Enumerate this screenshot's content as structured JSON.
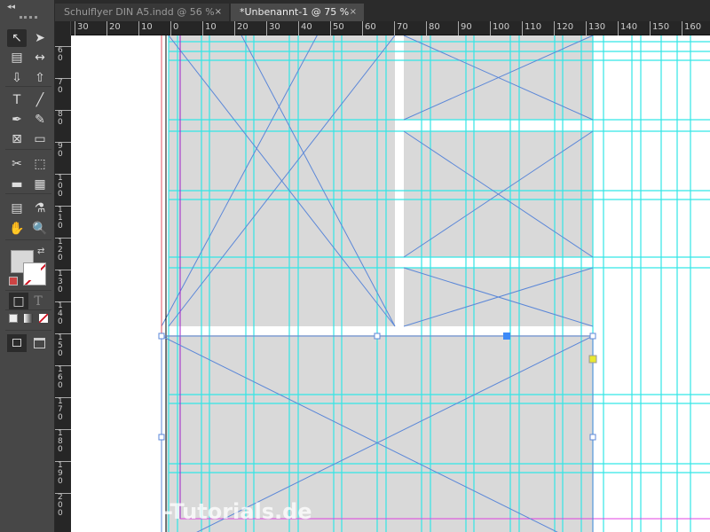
{
  "panel": {
    "collapse_label": "◂◂"
  },
  "tabs": [
    {
      "label": "Schulflyer DIN A5.indd @ 56 %",
      "close": "×",
      "active": false
    },
    {
      "label": "*Unbenannt-1 @ 75 %",
      "close": "×",
      "active": true
    }
  ],
  "ruler": {
    "horizontal_labels": [
      "30",
      "20",
      "10",
      "0",
      "10",
      "20",
      "30",
      "40",
      "50",
      "60",
      "70",
      "80",
      "90",
      "100",
      "110",
      "120",
      "130",
      "140",
      "150",
      "160"
    ],
    "vertical_labels": [
      "60",
      "70",
      "80",
      "90",
      "100",
      "110",
      "120",
      "130",
      "140",
      "150",
      "160",
      "170",
      "180",
      "190",
      "200"
    ]
  },
  "tools": [
    {
      "name": "selection-tool",
      "glyph": "↖",
      "active": true
    },
    {
      "name": "direct-selection-tool",
      "glyph": "➤"
    },
    {
      "name": "page-tool",
      "glyph": "▤"
    },
    {
      "name": "gap-tool",
      "glyph": "↔"
    },
    {
      "name": "content-collector-tool",
      "glyph": "⇩"
    },
    {
      "name": "content-placer-tool",
      "glyph": "⇧"
    },
    {
      "name": "type-tool",
      "glyph": "T"
    },
    {
      "name": "line-tool",
      "glyph": "╱"
    },
    {
      "name": "pen-tool",
      "glyph": "✒"
    },
    {
      "name": "pencil-tool",
      "glyph": "✎"
    },
    {
      "name": "rectangle-frame-tool",
      "glyph": "⊠"
    },
    {
      "name": "rectangle-tool",
      "glyph": "▭"
    },
    {
      "name": "scissors-tool",
      "glyph": "✂"
    },
    {
      "name": "free-transform-tool",
      "glyph": "⬚"
    },
    {
      "name": "gradient-swatch-tool",
      "glyph": "▬"
    },
    {
      "name": "gradient-feather-tool",
      "glyph": "▦"
    },
    {
      "name": "note-tool",
      "glyph": "▤"
    },
    {
      "name": "eyedropper-tool",
      "glyph": "⚗"
    },
    {
      "name": "hand-tool",
      "glyph": "✋"
    },
    {
      "name": "zoom-tool",
      "glyph": "🔍"
    }
  ],
  "format": {
    "container": "□",
    "text": "T"
  },
  "watermark": "-Tutorials.de",
  "colors": {
    "guide": "#33e6e6",
    "frame": "#5b87d8",
    "margin": "#a020c8",
    "bleed": "#e040e0",
    "page_fill": "#d9d9d9",
    "selected_anchor": "#3d8af7",
    "yellow_handle": "#e8e830"
  }
}
